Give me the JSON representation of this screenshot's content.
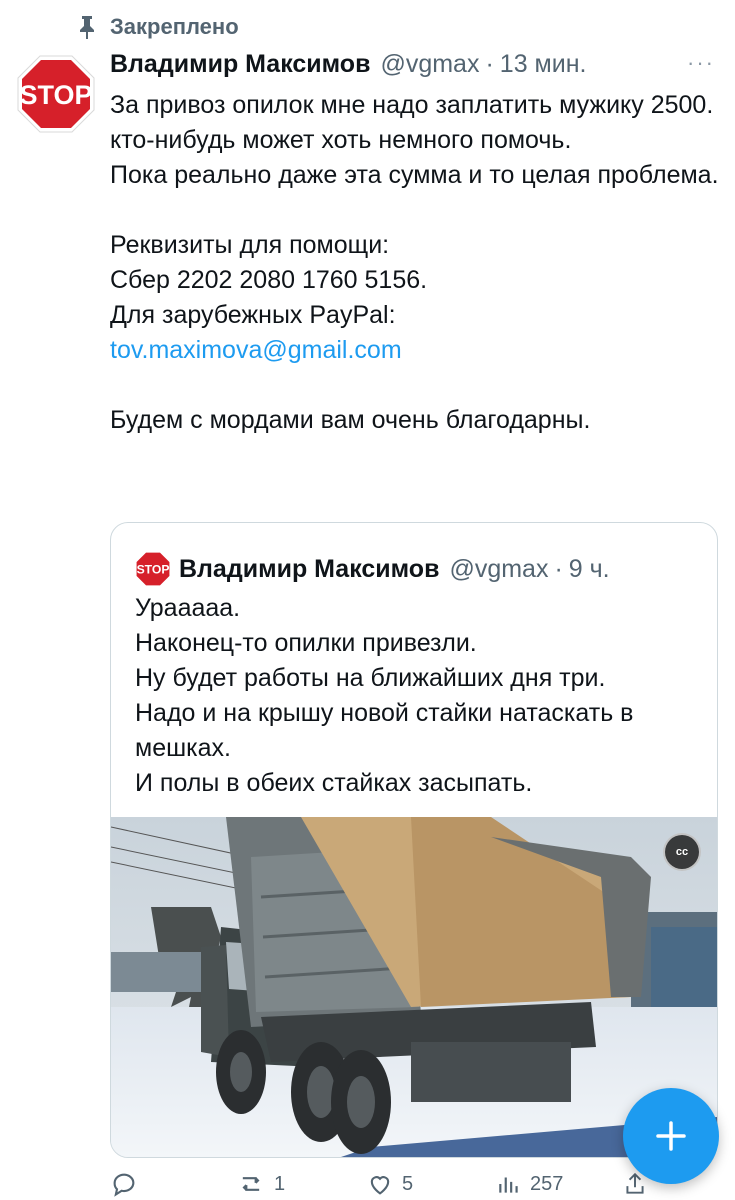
{
  "pinned": {
    "label": "Закреплено",
    "icon": "pin-icon"
  },
  "avatar": {
    "text": "STOP",
    "color": "#d6202a"
  },
  "tweet": {
    "name": "Владимир Максимов",
    "handle": "@vgmax",
    "dot": "·",
    "time": "13 мин.",
    "more": "···",
    "lines": [
      "За привоз опилок мне надо заплатить мужику 2500.",
      "кто-нибудь может хоть немного помочь.",
      "Пока реально даже эта сумма и то целая проблема."
    ],
    "requisites_title": "Реквизиты для помощи:",
    "sber": "Сбер  2202 2080 1760 5156.",
    "paypal": "Для зарубежных  PayPal:",
    "email": "tov.maximova@gmail.com",
    "closing": "Будем с мордами вам очень благодарны."
  },
  "quote": {
    "name": "Владимир Максимов",
    "handle": "@vgmax",
    "dot": "·",
    "time": "9 ч.",
    "lines": [
      "Ураaааа.",
      "Наконец-то опилки привезли.",
      "Ну будет работы на ближайших дня три.",
      "Надо и на крышу новой стайки натаскать в мешках.",
      "И полы в обеих стайках засыпать."
    ],
    "media": {
      "type": "video",
      "caption_badge": "cc",
      "description_icon": "dump-truck-photo"
    }
  },
  "actions": {
    "reply": {
      "icon": "reply-icon",
      "count": ""
    },
    "retweet": {
      "icon": "retweet-icon",
      "count": "1"
    },
    "like": {
      "icon": "heart-icon",
      "count": "5"
    },
    "views": {
      "icon": "views-icon",
      "count": "257"
    },
    "share": {
      "icon": "share-icon",
      "count": ""
    }
  },
  "fab": {
    "label": "+",
    "color": "#1d9bf0"
  }
}
